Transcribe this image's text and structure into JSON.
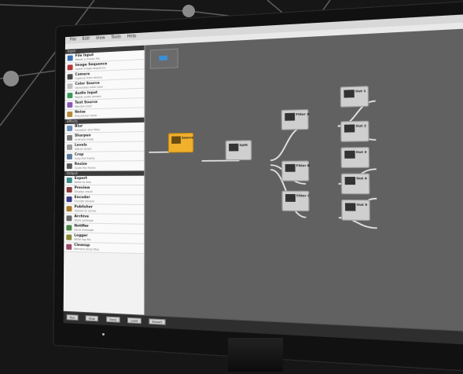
{
  "app": {
    "menu": [
      "File",
      "Edit",
      "View",
      "Tools",
      "Help"
    ]
  },
  "left_panel": {
    "categories": [
      {
        "title": "Input",
        "items": [
          {
            "label": "File Input",
            "desc": "Reads a media file",
            "color": "#3a6fb5"
          },
          {
            "label": "Image Sequence",
            "desc": "Loads image sequence",
            "color": "#b53a3a"
          },
          {
            "label": "Camera",
            "desc": "Capture from device",
            "color": "#4a4a4a"
          },
          {
            "label": "Color Source",
            "desc": "Generates solid color",
            "color": "#c0c0c0"
          },
          {
            "label": "Audio Input",
            "desc": "Reads audio stream",
            "color": "#3a9a5a"
          },
          {
            "label": "Text Source",
            "desc": "Renders text",
            "color": "#8a5ab5"
          },
          {
            "label": "Noise",
            "desc": "Procedural noise",
            "color": "#b58a3a"
          }
        ]
      },
      {
        "title": "Effects",
        "items": [
          {
            "label": "Blur",
            "desc": "Gaussian blur filter",
            "color": "#6b8fb5"
          },
          {
            "label": "Sharpen",
            "desc": "Unsharp mask",
            "color": "#7a7a7a"
          },
          {
            "label": "Levels",
            "desc": "Adjust levels",
            "color": "#9a9a9a"
          },
          {
            "label": "Crop",
            "desc": "Crop the frame",
            "color": "#5a7a9a"
          },
          {
            "label": "Resize",
            "desc": "Scale the frame",
            "color": "#5a5a5a"
          }
        ]
      },
      {
        "title": "Output",
        "items": [
          {
            "label": "Export",
            "desc": "Write to disk",
            "color": "#3a8a8a"
          },
          {
            "label": "Preview",
            "desc": "Display result",
            "color": "#8a3a3a"
          },
          {
            "label": "Encoder",
            "desc": "Encode stream",
            "color": "#3a3a8a"
          },
          {
            "label": "Publisher",
            "desc": "Upload to server",
            "color": "#aa7a2a"
          },
          {
            "label": "Archive",
            "desc": "Store package",
            "color": "#6a6a6a"
          },
          {
            "label": "Notifier",
            "desc": "Send message",
            "color": "#4a8a4a"
          },
          {
            "label": "Logger",
            "desc": "Write log file",
            "color": "#8a8a3a"
          },
          {
            "label": "Cleanup",
            "desc": "Remove temp files",
            "color": "#9a4a6a"
          }
        ]
      }
    ]
  },
  "canvas": {
    "nodes": [
      {
        "id": "n1",
        "label": "Source",
        "active": true
      },
      {
        "id": "n2",
        "label": "Split"
      },
      {
        "id": "n3",
        "label": "Filter A"
      },
      {
        "id": "n4",
        "label": "Filter B"
      },
      {
        "id": "n5",
        "label": "Filter C"
      },
      {
        "id": "n6",
        "label": "Out 1"
      },
      {
        "id": "n7",
        "label": "Out 2"
      },
      {
        "id": "n8",
        "label": "Out 3"
      },
      {
        "id": "n9",
        "label": "Out 4"
      },
      {
        "id": "n10",
        "label": "Out 5"
      }
    ]
  },
  "statusbar": {
    "buttons": [
      "Run",
      "Stop",
      "Save",
      "Load",
      "Export"
    ]
  },
  "colors": {
    "accent_node": "#f0b02c",
    "minimap_view": "#3b8fd6"
  }
}
